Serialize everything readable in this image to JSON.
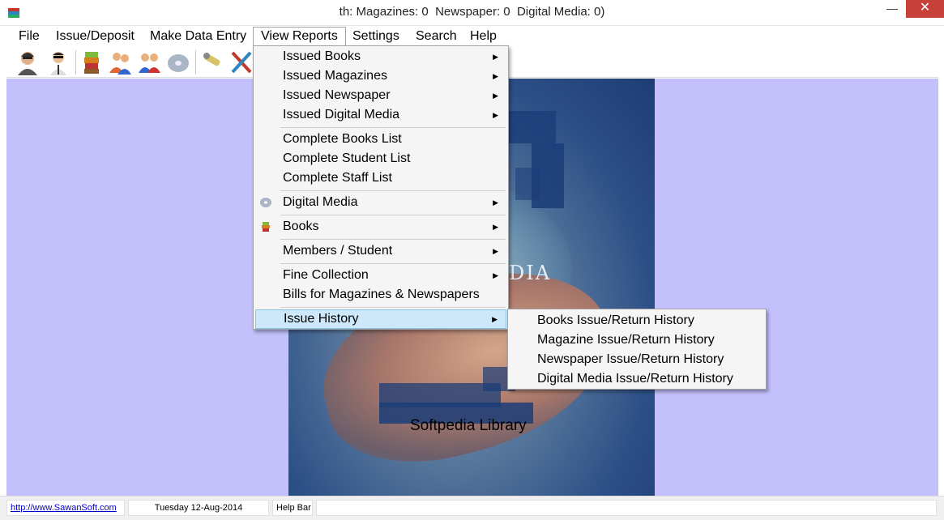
{
  "window": {
    "title": "th: Magazines: 0  Newspaper: 0  Digital Media: 0)",
    "minimize": "—",
    "maximize": "□",
    "close": "✕"
  },
  "menubar": [
    "File",
    "Issue/Deposit",
    "Make Data Entry",
    "View Reports",
    "Settings",
    "Search",
    "Help"
  ],
  "toolbar": {
    "icons": [
      "student-icon",
      "staff-icon",
      "books-icon",
      "members-icon",
      "issue-icon",
      "digital-media-icon",
      "search-icon",
      "tools-icon"
    ]
  },
  "view_reports_menu": {
    "items": [
      {
        "label": "Issued Books",
        "submenu": true
      },
      {
        "label": "Issued Magazines",
        "submenu": true
      },
      {
        "label": "Issued Newspaper",
        "submenu": true
      },
      {
        "label": "Issued Digital Media",
        "submenu": true
      },
      {
        "label": "Complete Books List",
        "submenu": false
      },
      {
        "label": "Complete Student List",
        "submenu": false
      },
      {
        "label": "Complete Staff List",
        "submenu": false
      },
      {
        "label": "Digital Media",
        "submenu": true,
        "icon": "cd-icon"
      },
      {
        "label": "Books",
        "submenu": true,
        "icon": "book-icon"
      },
      {
        "label": "Members / Student",
        "submenu": true
      },
      {
        "label": "Fine Collection",
        "submenu": true
      },
      {
        "label": "Bills for Magazines & Newspapers",
        "submenu": false
      },
      {
        "label": "Issue History",
        "submenu": true,
        "highlighted": true
      }
    ],
    "arrow": "▶"
  },
  "issue_history_submenu": [
    "Books Issue/Return History",
    "Magazine Issue/Return History",
    "Newspaper Issue/Return History",
    "Digital Media Issue/Return History"
  ],
  "background": {
    "caption": "Softpedia Library",
    "watermark": "DIA"
  },
  "statusbar": {
    "link": "http://www.SawanSoft.com",
    "date": "Tuesday 12-Aug-2014",
    "help": "Help Bar"
  },
  "colors": {
    "workspace": "#c3c0fb",
    "highlight": "#cde7fb",
    "close_button": "#c7403a"
  }
}
